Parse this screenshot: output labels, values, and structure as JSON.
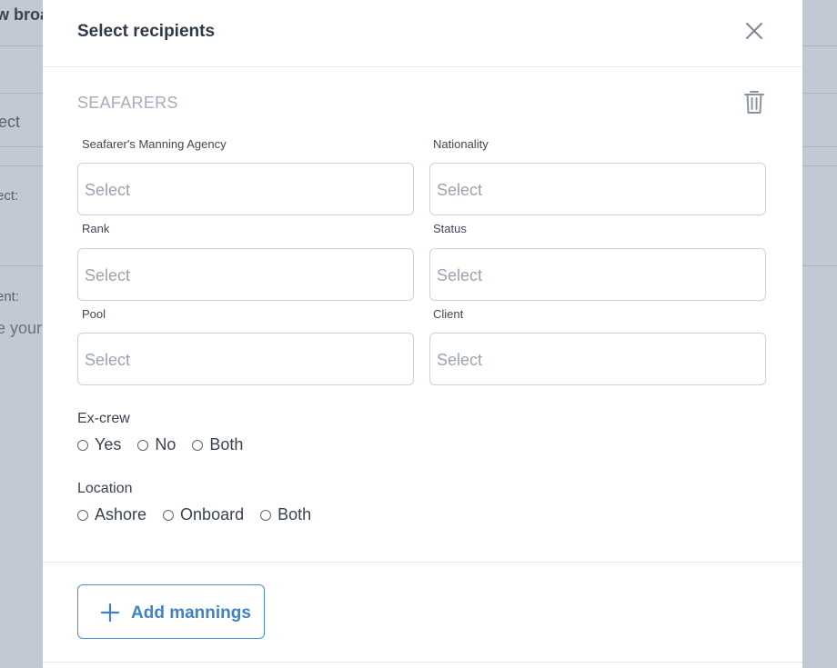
{
  "background": {
    "fragments": [
      "w broa",
      "ect",
      "ect:",
      "ent:",
      "e your"
    ]
  },
  "modal": {
    "title": "Select recipients",
    "section_title": "SEAFARERS",
    "fields": [
      {
        "label": "Seafarer's Manning Agency",
        "placeholder": "Select"
      },
      {
        "label": "Nationality",
        "placeholder": "Select"
      },
      {
        "label": "Rank",
        "placeholder": "Select"
      },
      {
        "label": "Status",
        "placeholder": "Select"
      },
      {
        "label": "Pool",
        "placeholder": "Select"
      },
      {
        "label": "Client",
        "placeholder": "Select"
      }
    ],
    "excrew": {
      "label": "Ex-crew",
      "options": [
        "Yes",
        "No",
        "Both"
      ]
    },
    "location": {
      "label": "Location",
      "options": [
        "Ashore",
        "Onboard",
        "Both"
      ]
    },
    "add_button_label": "Add mannings"
  },
  "icons": {
    "close": "close-icon",
    "trash": "trash-icon",
    "plus": "plus-icon"
  },
  "colors": {
    "accent": "#3f82c8",
    "overlay": "#c3c9d3",
    "muted_title": "#a3adbb"
  }
}
